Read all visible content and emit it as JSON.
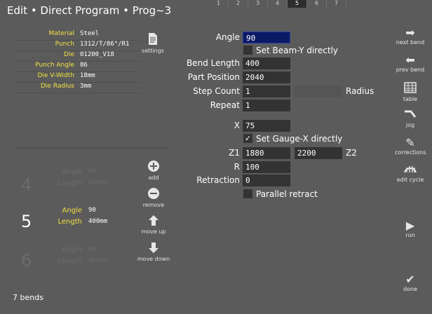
{
  "header": {
    "title": "Edit  •  Direct Program  •  Prog~3",
    "tabs": [
      "1",
      "2",
      "3",
      "4",
      "5",
      "6",
      "7"
    ],
    "active_tab": "5"
  },
  "params": [
    {
      "label": "Material",
      "value": "Steel"
    },
    {
      "label": "Punch",
      "value": "1312/T/86°/R1"
    },
    {
      "label": "Die",
      "value": "01200_V18"
    },
    {
      "label": "Punch Angle",
      "value": "86"
    },
    {
      "label": "Die V-Width",
      "value": "18mm"
    },
    {
      "label": "Die Radius",
      "value": "3mm"
    }
  ],
  "settings": {
    "label": "settings",
    "icon": "document-icon"
  },
  "steps": [
    {
      "num": "4",
      "angle_label": "Angle",
      "angle": "90",
      "length_label": "Length",
      "length": "400mm",
      "active": false
    },
    {
      "num": "5",
      "angle_label": "Angle",
      "angle": "90",
      "length_label": "Length",
      "length": "400mm",
      "active": true
    },
    {
      "num": "6",
      "angle_label": "Angle",
      "angle": "90",
      "length_label": "Length",
      "length": "400mm",
      "active": false
    }
  ],
  "list_actions": {
    "add": "add",
    "remove": "remove",
    "move_up": "move up",
    "move_down": "move down"
  },
  "form": {
    "angle_label": "Angle",
    "angle": "90",
    "set_beam_label": "Set Beam-Y directly",
    "bend_length_label": "Bend Length",
    "bend_length": "400",
    "part_position_label": "Part Position",
    "part_position": "2040",
    "step_count_label": "Step Count",
    "step_count": "1",
    "radius_label": "Radius",
    "radius": "",
    "repeat_label": "Repeat",
    "repeat": "1",
    "x_label": "X",
    "x": "75",
    "set_gauge_label": "Set Gauge-X directly",
    "z1_label": "Z1",
    "z1": "1880",
    "z2": "2200",
    "z2_label": "Z2",
    "r_label": "R",
    "r": "100",
    "retraction_label": "Retraction",
    "retraction": "0",
    "parallel_label": "Parallel retract"
  },
  "right_toolbar": [
    {
      "label": "next bend",
      "icon": "arrow-right-icon"
    },
    {
      "label": "prev bend",
      "icon": "arrow-left-icon"
    },
    {
      "label": "table",
      "icon": "table-icon"
    },
    {
      "label": "jog",
      "icon": "jog-icon"
    },
    {
      "label": "corrections",
      "icon": "pencil-icon"
    },
    {
      "label": "edit cycle",
      "icon": "cycle-icon"
    },
    {
      "label": "run",
      "icon": "play-icon"
    },
    {
      "label": "done",
      "icon": "check-icon"
    }
  ],
  "footer": {
    "bends": "7 bends"
  }
}
